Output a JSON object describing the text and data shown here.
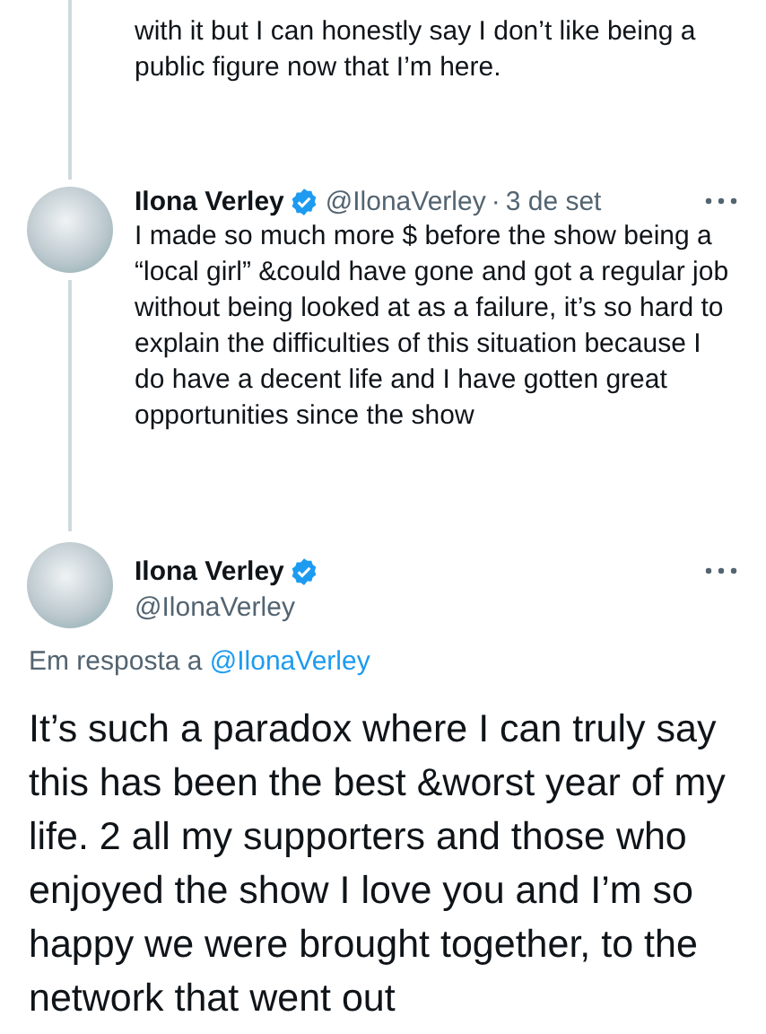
{
  "thread": [
    {
      "kind": "continuation",
      "text": "with it but I can honestly say I don’t like being a public figure now that I’m here."
    },
    {
      "kind": "reply",
      "name": "Ilona Verley",
      "verified": true,
      "handle": "@IlonaVerley",
      "separator": "·",
      "date": "3 de set",
      "text": "I made so much more $ before the show being a “local girl” &could have gone and got a regular job without being looked at as a failure, it’s so hard to explain the difficulties of this situation because I do have a decent life and I have gotten great opportunities since the show"
    }
  ],
  "focused": {
    "name": "Ilona Verley",
    "verified": true,
    "handle": "@IlonaVerley",
    "reply_prefix": "Em resposta a",
    "reply_to": "@IlonaVerley",
    "text": "It’s such a paradox where I can truly say this has been the best &worst year of my life. 2 all my supporters and those who enjoyed the show I love you and I’m so happy we were brought together, to the network that went out"
  }
}
